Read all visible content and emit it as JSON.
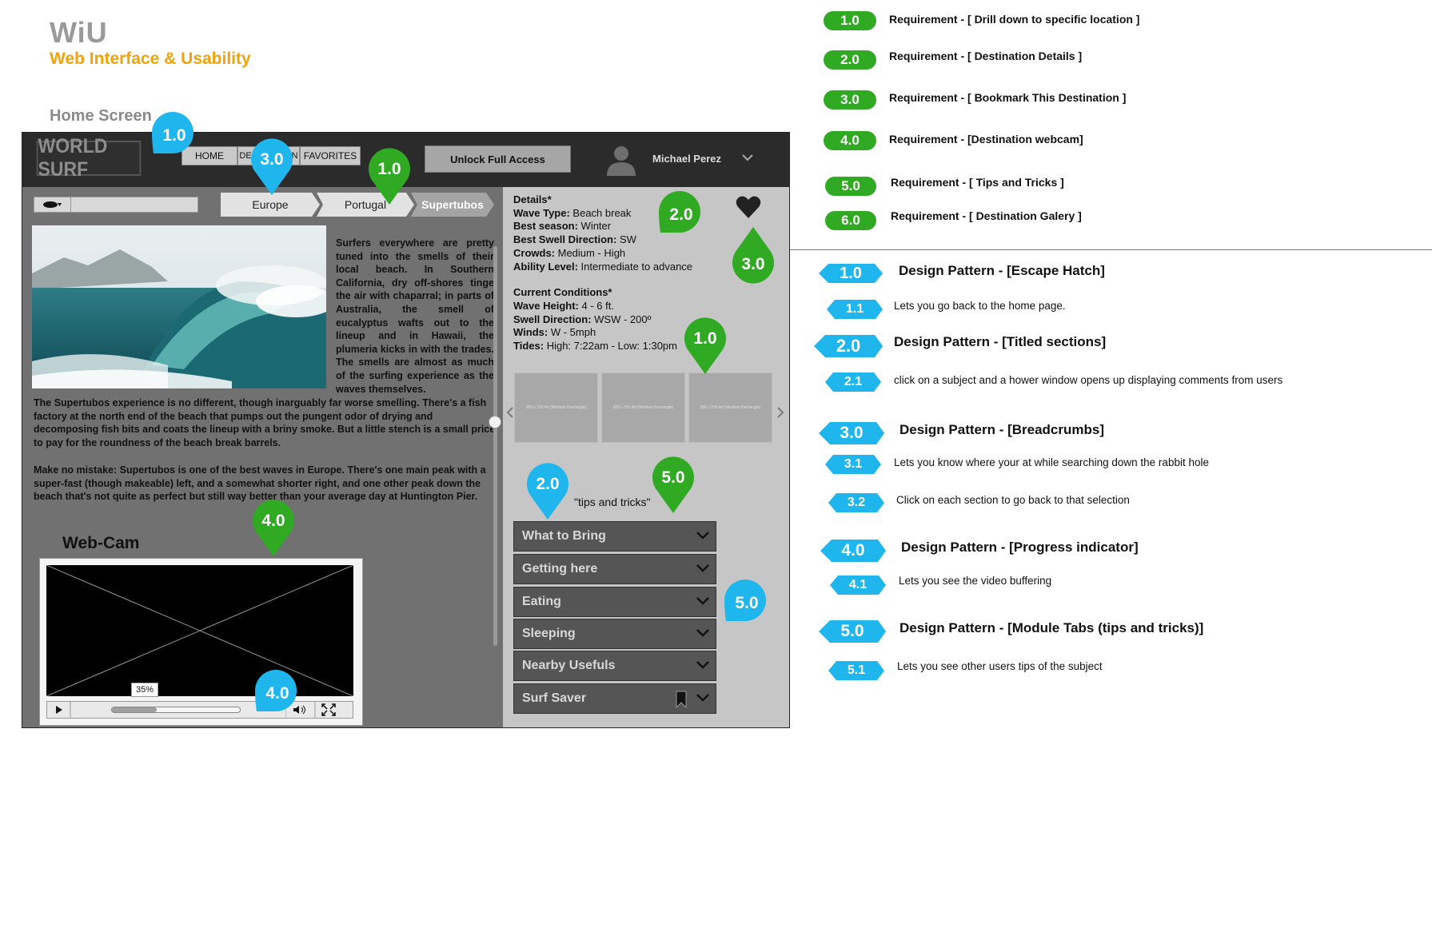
{
  "header": {
    "title": "WiU",
    "subtitle": "Web Interface & Usability",
    "screen": "Home Screen"
  },
  "app": {
    "logo": "WORLD SURF",
    "nav": [
      "HOME",
      "DESTINATION",
      "FAVORITES"
    ],
    "unlock": "Unlock Full Access",
    "user": "Michael Perez"
  },
  "breadcrumbs": [
    "Europe",
    "Portugal",
    "Supertubos"
  ],
  "article": {
    "p1": "Surfers everywhere are pretty tuned into the smells of their local beach. In Southern California, dry off-shores tinge the air with chaparral; in parts of Australia, the smell of eucalyptus wafts out to the lineup and in Hawaii, the plumeria kicks in with the trades. The smells are almost as much of the surfing experience as the waves themselves.",
    "p2": "The Supertubos experience is no different, though inarguably far worse smelling. There's a fish factory at the north end of the beach that pumps out the pungent odor of drying and decomposing fish bits and coats the lineup with a briny smoke. But a little stench is a small price to pay for the roundness of the beach break barrels.",
    "p3": "Make no mistake: Supertubos is one of the best waves in Europe. There's one main peak with a super-fast (though makeable) left, and a somewhat shorter right, and one other peak down the beach that's not quite as perfect but still way better than your average day at Huntington Pier."
  },
  "webcam": {
    "label": "Web-Cam",
    "buffer_label": "35%",
    "buffer_value": 0.35
  },
  "details": {
    "heading": "Details*",
    "rows": [
      {
        "k": "Wave Type:",
        "v": "Beach break"
      },
      {
        "k": "Best season:",
        "v": "Winter"
      },
      {
        "k": "Best Swell Direction:",
        "v": "SW"
      },
      {
        "k": "Crowds:",
        "v": "Medium - High"
      },
      {
        "k": "Ability Level:",
        "v": "Intermediate to advance"
      }
    ],
    "conditions_heading": "Current Conditions*",
    "conditions": [
      {
        "k": "Wave Height:",
        "v": "4 - 6 ft."
      },
      {
        "k": "Swell Direction:",
        "v": "WSW - 200º"
      },
      {
        "k": "Winds:",
        "v": "W - 5mph"
      },
      {
        "k": "Tides:",
        "v": "High: 7:22am - Low: 1:30pm"
      }
    ]
  },
  "gallery": {
    "thumb_label": "300 x 250 Ad (Medium Rectangle)"
  },
  "tips": {
    "label": "\"tips and tricks\"",
    "items": [
      "What to Bring",
      "Getting here",
      "Eating",
      "Sleeping",
      "Nearby Usefuls",
      "Surf Saver"
    ]
  },
  "requirements": [
    {
      "num": "1.0",
      "text": "Requirement - [ Drill down to specific location ]"
    },
    {
      "num": "2.0",
      "text": "Requirement - [ Destination Details ]"
    },
    {
      "num": "3.0",
      "text": "Requirement - [ Bookmark This Destination ]"
    },
    {
      "num": "4.0",
      "text": "Requirement - [Destination  webcam]"
    },
    {
      "num": "5.0",
      "text": "Requirement - [ Tips and Tricks ]"
    },
    {
      "num": "6.0",
      "text": "Requirement - [ Destination Galery ]"
    }
  ],
  "patterns": [
    {
      "num": "1.0",
      "text": "Design Pattern - [Escape Hatch]",
      "subs": [
        {
          "num": "1.1",
          "text": "Lets you go back to the home page."
        }
      ]
    },
    {
      "num": "2.0",
      "text": "Design Pattern - [Titled sections]",
      "subs": [
        {
          "num": "2.1",
          "text": "click on a subject and a hower window opens up displaying comments from users"
        }
      ]
    },
    {
      "num": "3.0",
      "text": "Design Pattern - [Breadcrumbs]",
      "subs": [
        {
          "num": "3.1",
          "text": "Lets you know where your at while searching down the rabbit hole"
        },
        {
          "num": "3.2",
          "text": "Click on each section to go back to that selection"
        }
      ]
    },
    {
      "num": "4.0",
      "text": "Design Pattern - [Progress indicator]",
      "subs": [
        {
          "num": "4.1",
          "text": "Lets you see the video buffering"
        }
      ]
    },
    {
      "num": "5.0",
      "text": "Design Pattern - [Module Tabs (tips and tricks)]",
      "subs": [
        {
          "num": "5.1",
          "text": "Lets you see other users tips of the subject"
        }
      ]
    }
  ],
  "pins": [
    "1.0",
    "3.0",
    "1.0",
    "2.0",
    "3.0",
    "1.0",
    "2.0",
    "5.0",
    "5.0",
    "4.0",
    "4.0"
  ],
  "colors": {
    "green": "#2faa22",
    "blue": "#1fb6ee",
    "orange": "#f0a30a"
  }
}
